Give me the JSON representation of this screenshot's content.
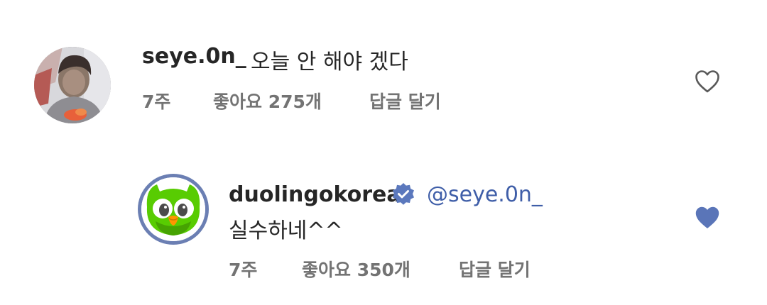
{
  "colors": {
    "text": "#262626",
    "meta": "#737373",
    "mention": "#3f5ea8",
    "liked_heart": "#5a75b8",
    "verified": "#5b78bd",
    "duolingo_green": "#58cc02"
  },
  "comments": [
    {
      "username": "seye.0n_",
      "text": "오늘 안 해야 겠다",
      "time": "7주",
      "likes": "좋아요 275개",
      "reply": "답글 달기",
      "liked": false,
      "avatar_icon": "user-photo-avatar"
    },
    {
      "username": "duolingokorea",
      "verified": true,
      "mention": "@seye.0n_",
      "text": "실수하네^^",
      "time": "7주",
      "likes": "좋아요 350개",
      "reply": "답글 달기",
      "liked": true,
      "avatar_icon": "duolingo-owl-avatar"
    }
  ]
}
